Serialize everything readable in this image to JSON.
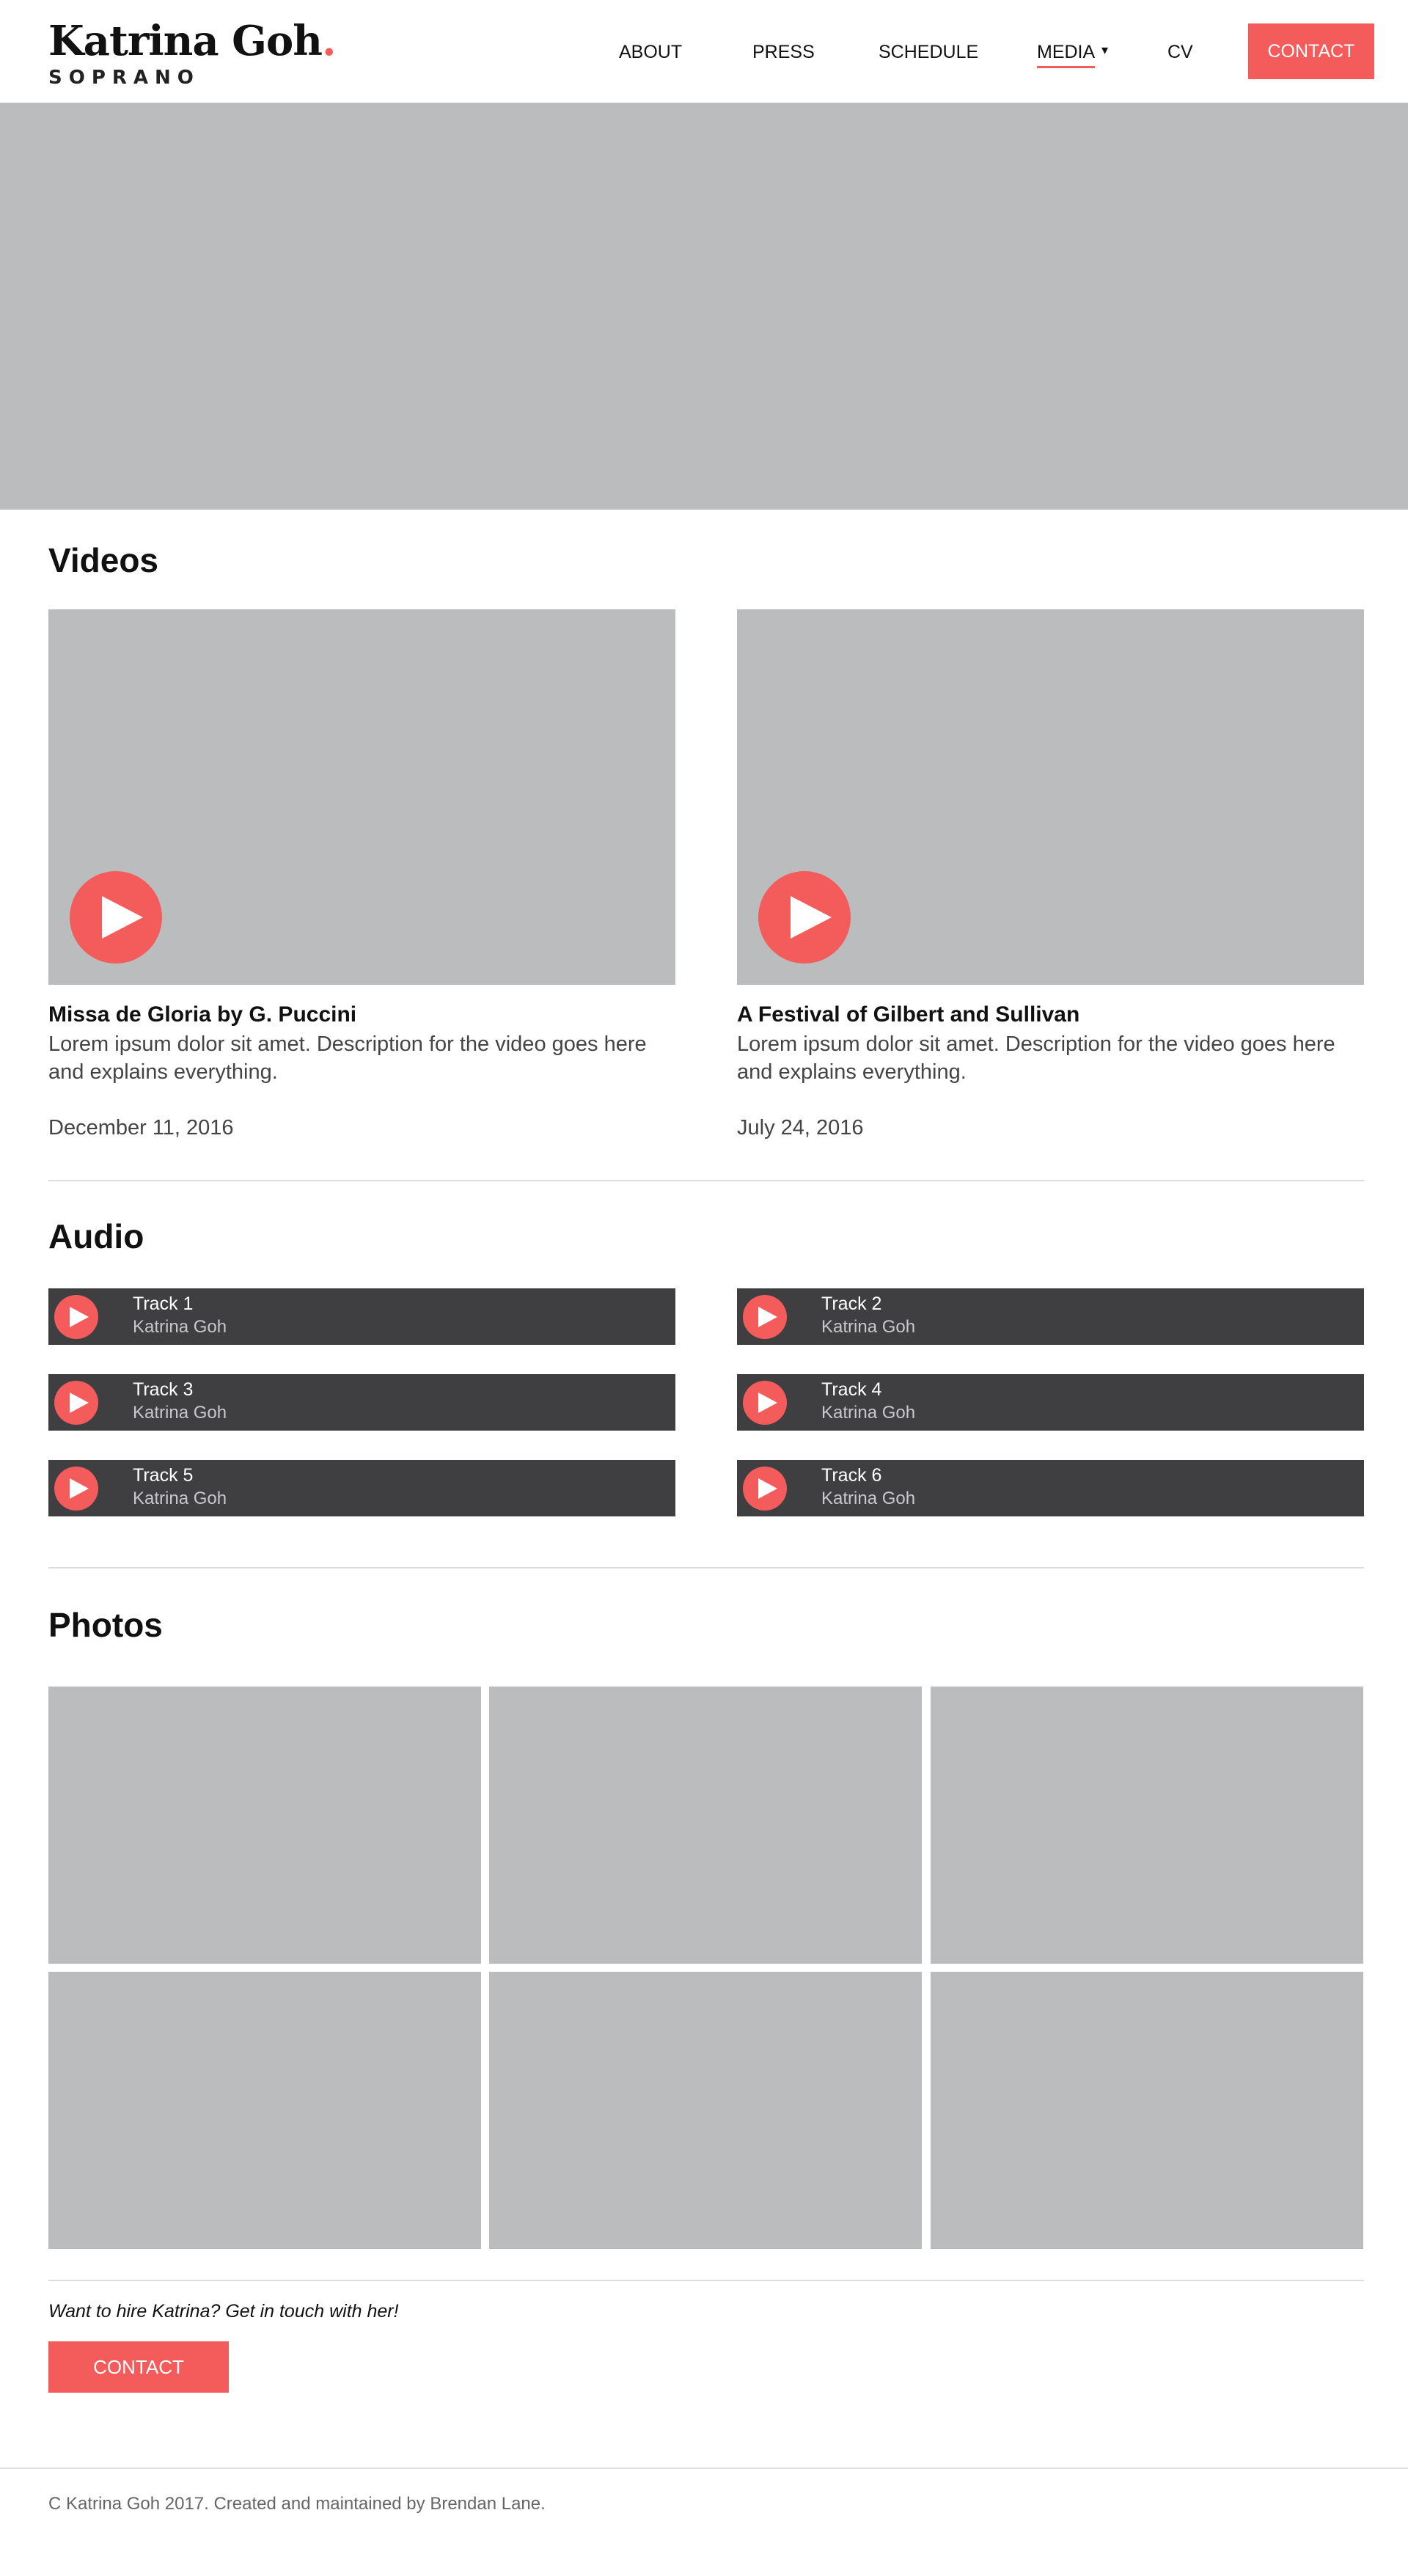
{
  "header": {
    "logo_name": "Katrina Goh",
    "logo_dot": ".",
    "logo_subtitle": "SOPRANO",
    "nav": {
      "about": "ABOUT",
      "press": "PRESS",
      "schedule": "SCHEDULE",
      "media": "MEDIA",
      "media_caret": "▾",
      "cv": "CV"
    },
    "contact_label": "CONTACT",
    "active_item": "MEDIA"
  },
  "videos": {
    "title": "Videos",
    "items": [
      {
        "title": "Missa de Gloria by G. Puccini",
        "description": "Lorem ipsum dolor sit amet. Description for the video goes here and explains everything.",
        "date": "December 11, 2016"
      },
      {
        "title": "A Festival of Gilbert and Sullivan",
        "description": "Lorem ipsum dolor sit amet. Description for the video goes here and explains everything.",
        "date": "July 24, 2016"
      }
    ]
  },
  "audio": {
    "title": "Audio",
    "tracks": [
      {
        "name": "Track 1",
        "artist": "Katrina Goh"
      },
      {
        "name": "Track 2",
        "artist": "Katrina Goh"
      },
      {
        "name": "Track 3",
        "artist": "Katrina Goh"
      },
      {
        "name": "Track 4",
        "artist": "Katrina Goh"
      },
      {
        "name": "Track 5",
        "artist": "Katrina Goh"
      },
      {
        "name": "Track 6",
        "artist": "Katrina Goh"
      }
    ]
  },
  "photos": {
    "title": "Photos"
  },
  "hire": {
    "text": "Want to hire Katrina? Get in touch with her!",
    "button_label": "CONTACT"
  },
  "footer": {
    "text": "C Katrina Goh 2017. Created and maintained by Brendan Lane."
  },
  "colors": {
    "accent": "#f45c5c",
    "placeholder": "#bbbcbe",
    "track_bg": "#3f3f42"
  },
  "icons": {
    "play": "play-icon",
    "caret": "chevron-down-icon"
  }
}
